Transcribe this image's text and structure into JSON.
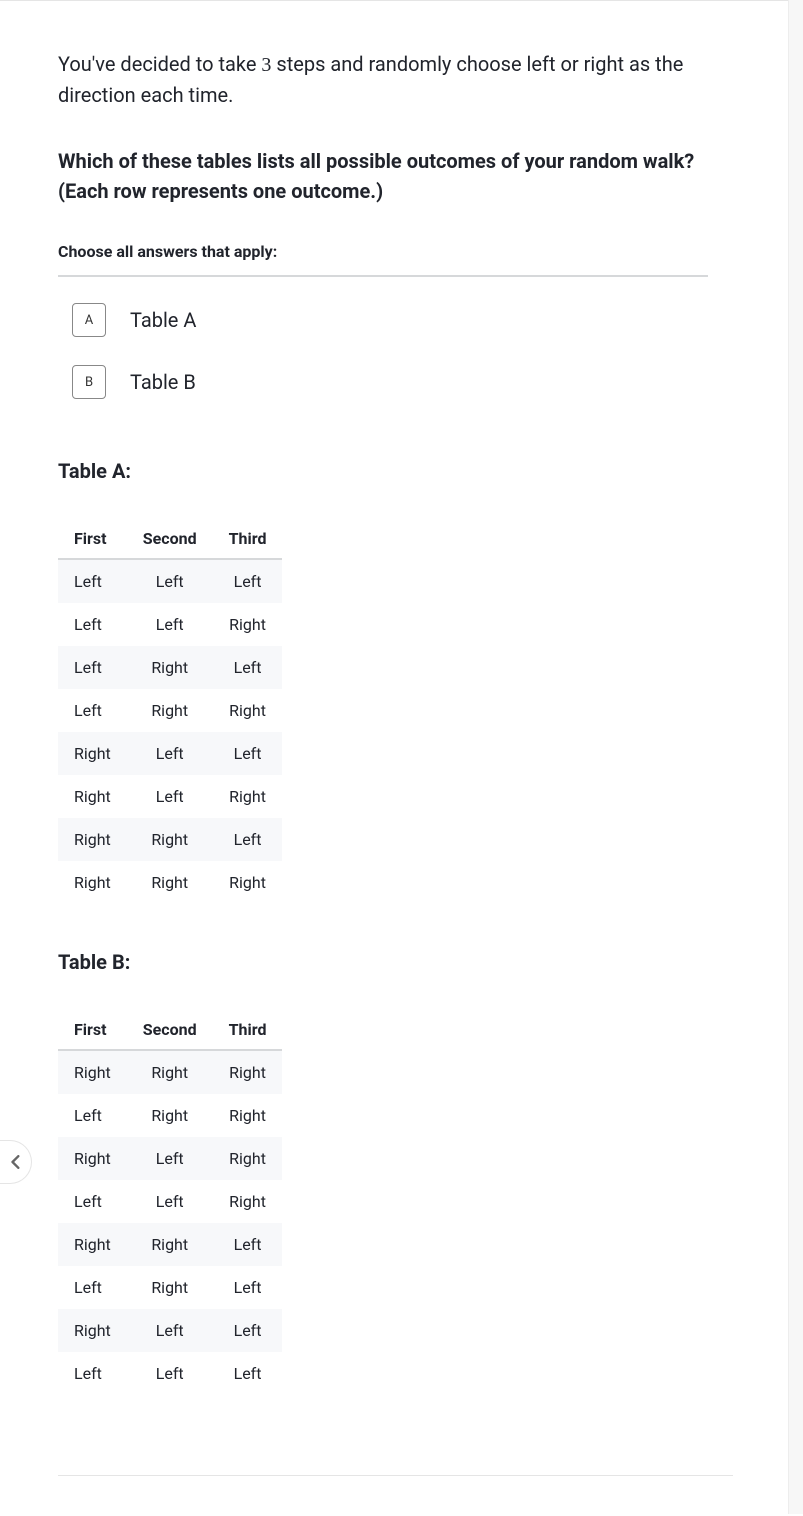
{
  "intro": {
    "part1": "You've decided to take ",
    "num": "3",
    "part2": " steps and randomly choose left or right as the direction each time."
  },
  "question": "Which of these tables lists all possible outcomes of your random walk? (Each row represents one outcome.)",
  "choose_label": "Choose all answers that apply:",
  "answers": [
    {
      "key": "A",
      "label": "Table A"
    },
    {
      "key": "B",
      "label": "Table B"
    }
  ],
  "tableA": {
    "title": "Table A:",
    "headers": [
      "First",
      "Second",
      "Third"
    ],
    "rows": [
      [
        "Left",
        "Left",
        "Left"
      ],
      [
        "Left",
        "Left",
        "Right"
      ],
      [
        "Left",
        "Right",
        "Left"
      ],
      [
        "Left",
        "Right",
        "Right"
      ],
      [
        "Right",
        "Left",
        "Left"
      ],
      [
        "Right",
        "Left",
        "Right"
      ],
      [
        "Right",
        "Right",
        "Left"
      ],
      [
        "Right",
        "Right",
        "Right"
      ]
    ]
  },
  "tableB": {
    "title": "Table B:",
    "headers": [
      "First",
      "Second",
      "Third"
    ],
    "rows": [
      [
        "Right",
        "Right",
        "Right"
      ],
      [
        "Left",
        "Right",
        "Right"
      ],
      [
        "Right",
        "Left",
        "Right"
      ],
      [
        "Left",
        "Left",
        "Right"
      ],
      [
        "Right",
        "Right",
        "Left"
      ],
      [
        "Left",
        "Right",
        "Left"
      ],
      [
        "Right",
        "Left",
        "Left"
      ],
      [
        "Left",
        "Left",
        "Left"
      ]
    ]
  }
}
